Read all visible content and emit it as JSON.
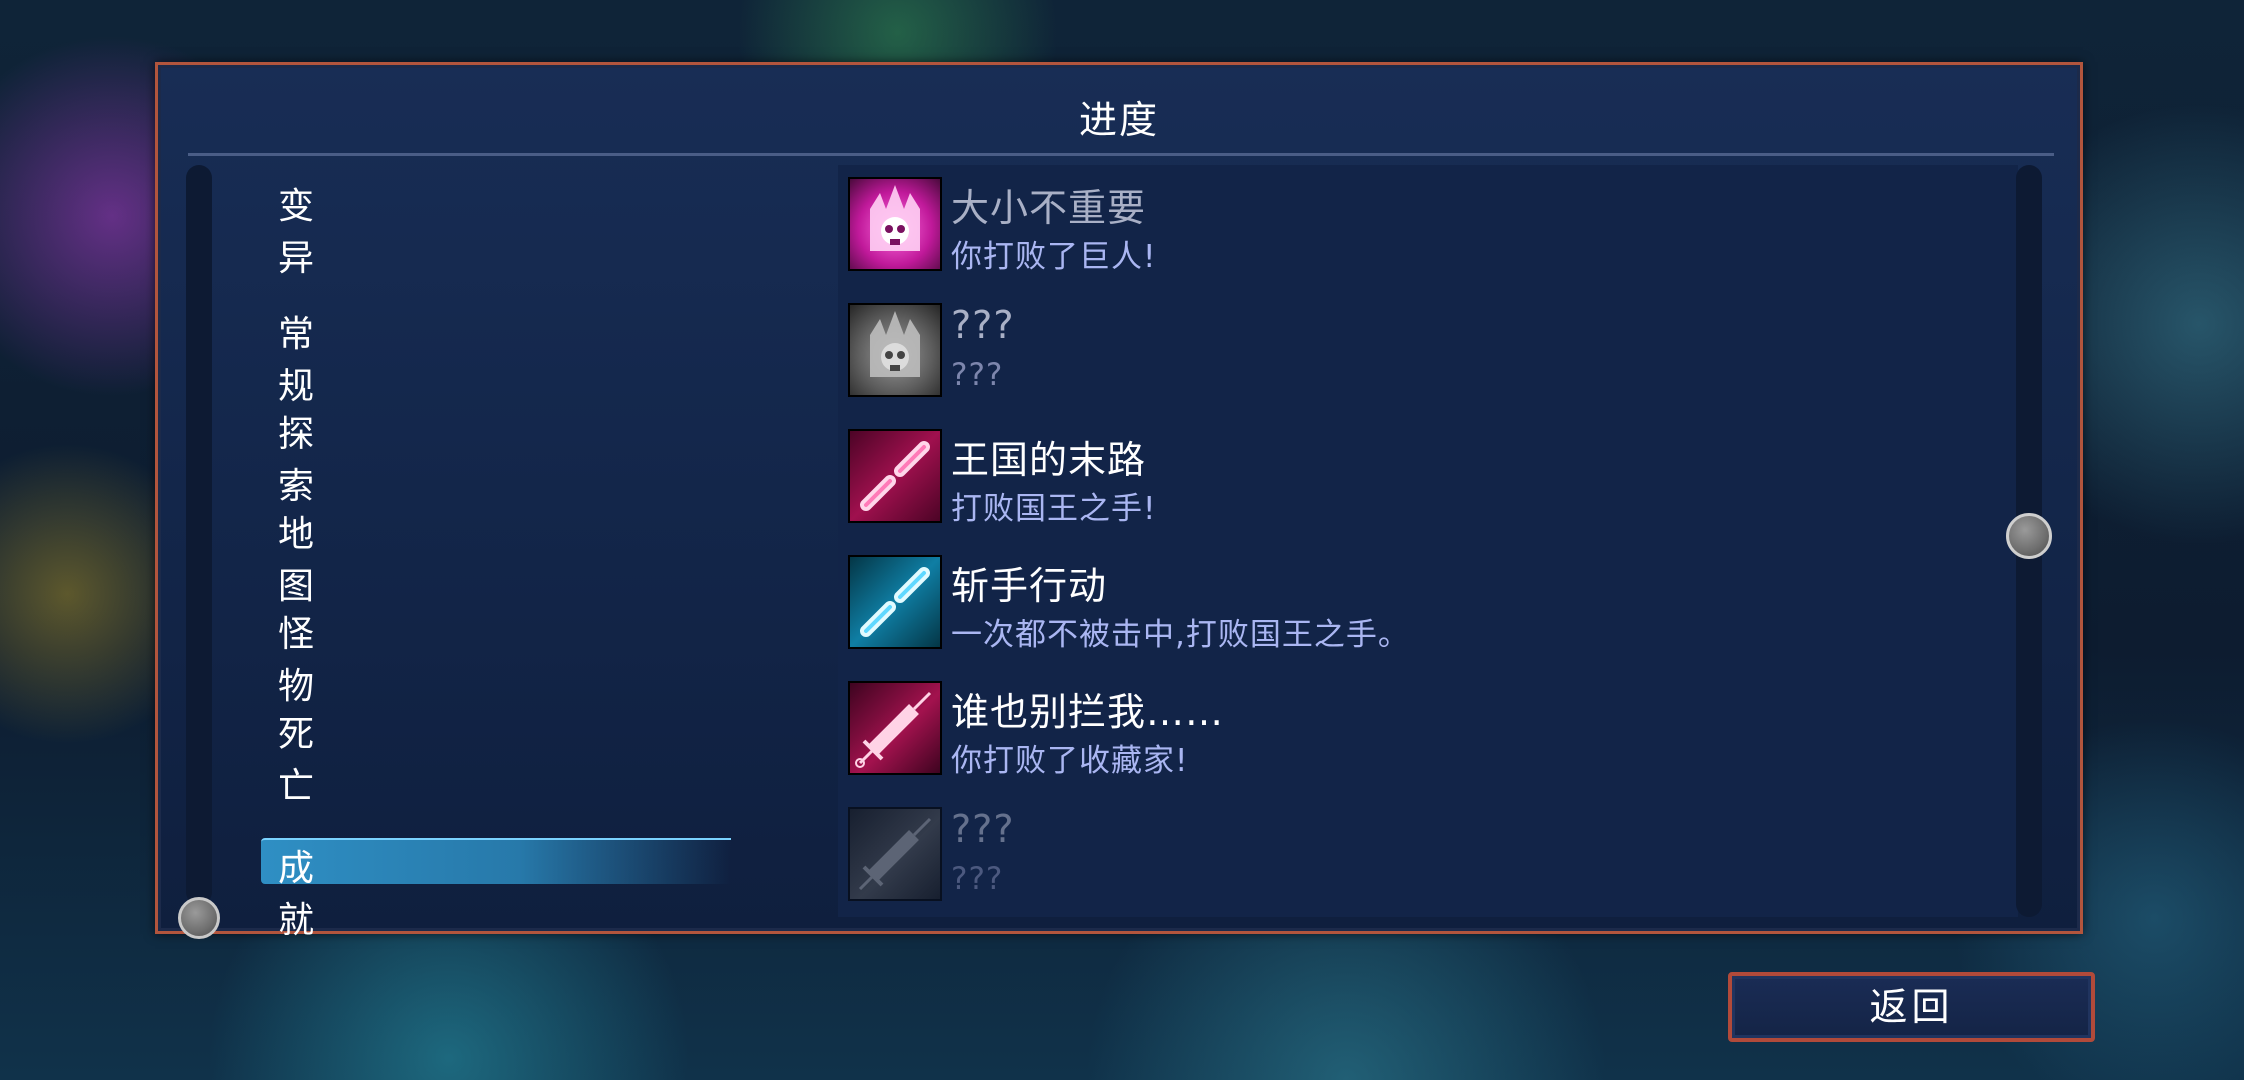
{
  "panel": {
    "title": "进度"
  },
  "menu": {
    "items": [
      {
        "label": "变异"
      },
      {
        "label": "常规"
      },
      {
        "label": "探索"
      },
      {
        "label": "地图"
      },
      {
        "label": "怪物"
      },
      {
        "label": "死亡"
      },
      {
        "label": "成就"
      }
    ],
    "selected": "成就"
  },
  "achievements": [
    {
      "name": "大小不重要",
      "desc": "你打败了巨人!",
      "icon": "giant-skull-crown-icon",
      "color": "#e02bb8",
      "unlocked": true
    },
    {
      "name": "???",
      "desc": "???",
      "icon": "giant-skull-crown-icon",
      "color": "#8a8a8a",
      "unlocked": false
    },
    {
      "name": "王国的末路",
      "desc": "打败国王之手!",
      "icon": "twin-blades-icon",
      "color": "#e5177a",
      "unlocked": true
    },
    {
      "name": "斩手行动",
      "desc": "一次都不被击中,打败国王之手。",
      "icon": "twin-blades-icon",
      "color": "#18a8d8",
      "unlocked": true
    },
    {
      "name": "谁也别拦我……",
      "desc": "你打败了收藏家!",
      "icon": "syringe-icon",
      "color": "#d81a66",
      "unlocked": true
    },
    {
      "name": "???",
      "desc": "???",
      "icon": "syringe-icon",
      "color": "#7a7a7a",
      "unlocked": false
    }
  ],
  "buttons": {
    "back": "返回"
  }
}
